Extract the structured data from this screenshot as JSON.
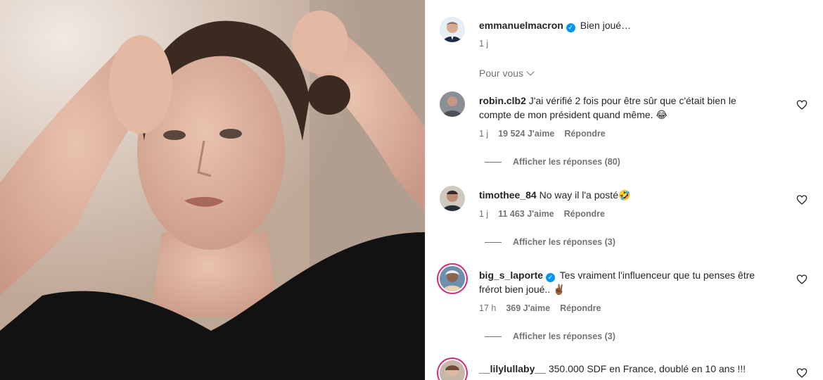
{
  "post": {
    "author": "emmanuelmacron",
    "caption": "Bien joué…",
    "age": "1 j"
  },
  "filter": {
    "label": "Pour vous"
  },
  "comments": [
    {
      "user": "robin.clb2",
      "verified": false,
      "text_line1": "J'ai vérifié 2 fois pour être sûr que c'était bien le",
      "text_line2": "compte de mon président quand même. 😂",
      "age": "1 j",
      "likes": "19 524 J'aime",
      "reply": "Répondre",
      "replies_label": "Afficher les réponses (80)"
    },
    {
      "user": "timothee_84",
      "verified": false,
      "text_line1": "No way il l'a posté🤣",
      "age": "1 j",
      "likes": "11 463 J'aime",
      "reply": "Répondre",
      "replies_label": "Afficher les réponses (3)"
    },
    {
      "user": "big_s_laporte",
      "verified": true,
      "text_line1": "Tes vraiment l'influenceur que tu penses être",
      "text_line2": "frérot bien joué.. ✌🏾",
      "age": "17 h",
      "likes": "369 J'aime",
      "reply": "Répondre",
      "replies_label": "Afficher les réponses (3)"
    },
    {
      "user": "__lilylullaby__",
      "verified": false,
      "text_line1": "350.000 SDF en France, doublé en 10 ans !!!"
    }
  ],
  "icons": {
    "verified": "verified-badge-icon",
    "heart": "heart-outline-icon",
    "chevron": "chevron-down-icon"
  },
  "colors": {
    "verified": "#0095f6",
    "meta_text": "#737373",
    "story_ring": "#d62976"
  }
}
